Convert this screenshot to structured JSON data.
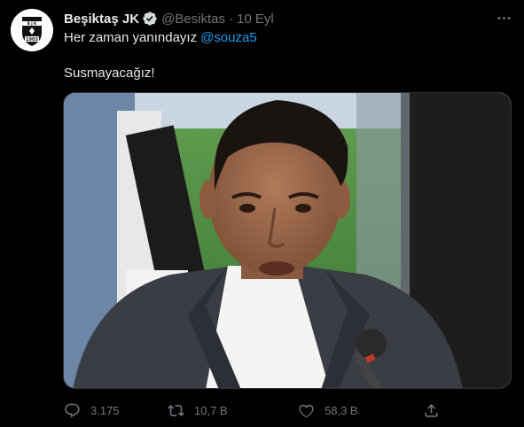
{
  "tweet": {
    "display_name": "Beşiktaş JK",
    "handle": "@Besiktas",
    "separator": "·",
    "date": "10 Eyl",
    "text_line1": "Her zaman yanındayız",
    "mention": "@souza5",
    "text_line2": "Susmayacağız!",
    "avatar_icon": "besiktas-crest-icon",
    "verified_icon": "verified-badge-icon",
    "more_icon": "more-options-icon",
    "avatar_badge_text": "1903"
  },
  "actions": {
    "reply": {
      "icon": "reply-icon",
      "count": "3.175"
    },
    "retweet": {
      "icon": "retweet-icon",
      "count": "10,7 B"
    },
    "like": {
      "icon": "heart-icon",
      "count": "58,3 B"
    },
    "share": {
      "icon": "share-icon"
    }
  },
  "colors": {
    "background": "#000000",
    "text": "#e7e9ea",
    "secondary": "#71767b",
    "link": "#1d9bf0"
  }
}
